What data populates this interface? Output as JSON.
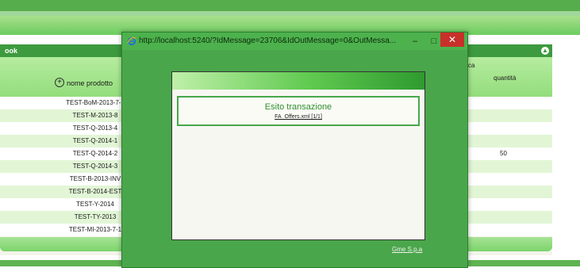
{
  "panel": {
    "title": "ook",
    "column_name": "nome prodotto",
    "column_right_top": "ca",
    "column_quantity": "quantità"
  },
  "rows": [
    {
      "name": "TEST-BoM-2013-7-2",
      "q": ""
    },
    {
      "name": "TEST-M-2013-8",
      "q": ""
    },
    {
      "name": "TEST-Q-2013-4",
      "q": ""
    },
    {
      "name": "TEST-Q-2014-1",
      "q": ""
    },
    {
      "name": "TEST-Q-2014-2",
      "q": "50"
    },
    {
      "name": "TEST-Q-2014-3",
      "q": ""
    },
    {
      "name": "TEST-B-2013-INV",
      "q": ""
    },
    {
      "name": "TEST-B-2014-EST",
      "q": ""
    },
    {
      "name": "TEST-Y-2014",
      "q": ""
    },
    {
      "name": "TEST-TY-2013",
      "q": ""
    },
    {
      "name": "TEST-MI-2013-7-1",
      "q": ""
    }
  ],
  "popup": {
    "title": "http://localhost:5240/?IdMessage=23706&IdOutMessage=0&OutMessa...",
    "min_label": "–",
    "max_label": "□",
    "close_label": "✕",
    "result_title": "Esito transazione",
    "result_link": "FA_Offers.xml [1/1]",
    "footer_link": "Gme S.p.a"
  },
  "colors": {
    "brand_green": "#3d9a3e",
    "row_alt": "#e2f6d6",
    "close_red": "#c9302a"
  },
  "icons": [
    "add-circle-icon",
    "collapse-icon",
    "ie-browser-icon"
  ]
}
